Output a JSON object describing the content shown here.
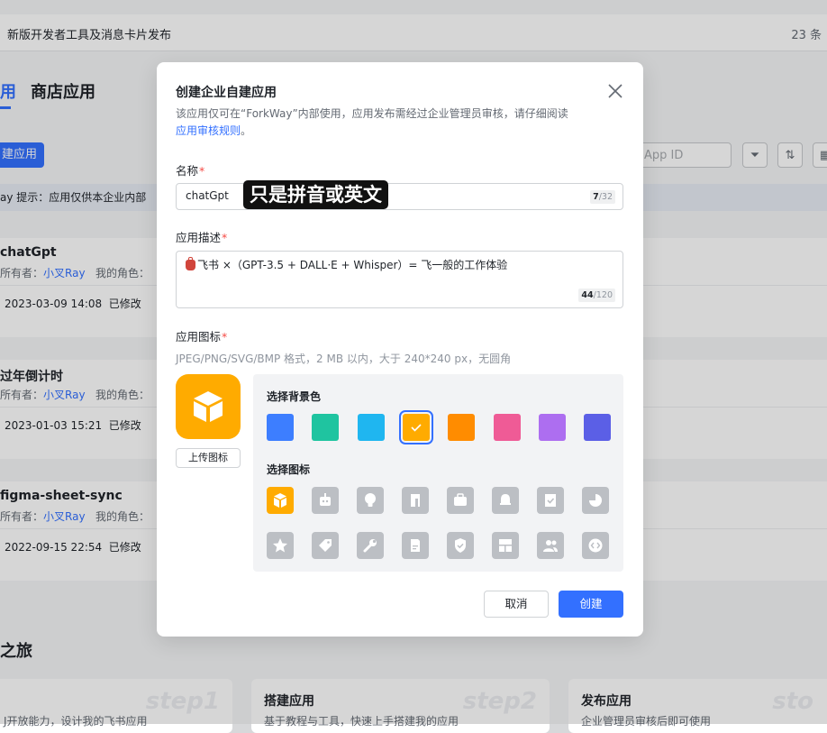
{
  "background": {
    "banner_title": "新版开发者工具及消息卡片发布",
    "banner_count": "23 条",
    "tab_active": "用",
    "tab_other": "商店应用",
    "create_button": "建应用",
    "search_placeholder": "App ID",
    "tip": "ay  提示：应用仅供本企业内部",
    "apps": [
      {
        "name": "chatGpt",
        "owner_label": "所有者：",
        "owner": "小叉Ray",
        "role": "我的角色：",
        "date": "2023-03-09 14:08",
        "status": "已修改"
      },
      {
        "name": "过年倒计时",
        "owner_label": "所有者：",
        "owner": "小叉Ray",
        "role": "我的角色：",
        "date": "2023-01-03 15:21",
        "status": "已修改"
      },
      {
        "name": "figma-sheet-sync",
        "owner_label": "所有者：",
        "owner": "小叉Ray",
        "role": "我的角色：",
        "date": "2022-09-15 22:54",
        "status": "已修改"
      }
    ],
    "journey_title": "之旅",
    "steps": [
      {
        "title": "",
        "sub": "J开放能力，设计我的飞书应用",
        "badge": "step1"
      },
      {
        "title": "搭建应用",
        "sub": "基于教程与工具，快速上手搭建我的应用",
        "badge": "step2"
      },
      {
        "title": "发布应用",
        "sub": "企业管理员审核后即可使用",
        "badge": "sto"
      }
    ]
  },
  "modal": {
    "title": "创建企业自建应用",
    "desc_prefix": "该应用仅可在“ForkWay”内部使用，应用发布需经过企业管理员审核，请仔细阅读",
    "desc_link": "应用审核规则",
    "desc_suffix": "。",
    "name_label": "名称",
    "name_value": "chatGpt",
    "name_count_current": "7",
    "name_count_max": "/32",
    "annotation": "只是拼音或英文",
    "desc_label": "应用描述",
    "desc_value": "飞书 ×（GPT-3.5 + DALL·E + Whisper）= 飞一般的工作体验",
    "desc_count_current": "44",
    "desc_count_max": "/120",
    "icon_label": "应用图标",
    "icon_hint": "JPEG/PNG/SVG/BMP 格式，2 MB 以内，大于 240*240 px，无圆角",
    "upload_label": "上传图标",
    "bg_color_title": "选择背景色",
    "bg_colors": [
      "#3d7eff",
      "#1fc4a0",
      "#1fb6f0",
      "#ffab00",
      "#ff8c00",
      "#ef5b96",
      "#ad6ef0",
      "#5b5fe6"
    ],
    "selected_bg_color": "#ffab00",
    "icon_title": "选择图标",
    "icons_row1": [
      "cube-icon",
      "robot-icon",
      "bulb-icon",
      "document-icon",
      "briefcase-icon",
      "bell-icon",
      "check-doc-icon",
      "pie-chart-icon"
    ],
    "icons_row2": [
      "star-icon",
      "tag-icon",
      "wrench-icon",
      "file-icon",
      "shield-icon",
      "layout-icon",
      "people-icon",
      "code-icon"
    ],
    "cancel_label": "取消",
    "ok_label": "创建"
  }
}
